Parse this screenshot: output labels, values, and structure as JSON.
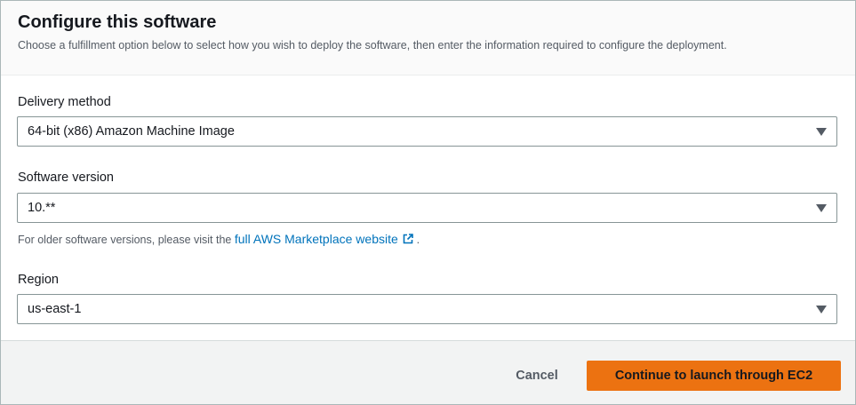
{
  "header": {
    "title": "Configure this software",
    "subtitle": "Choose a fulfillment option below to select how you wish to deploy the software, then enter the information required to configure the deployment."
  },
  "delivery_method": {
    "label": "Delivery method",
    "value": "64-bit (x86) Amazon Machine Image"
  },
  "software_version": {
    "label": "Software version",
    "value": "10.**",
    "hint_prefix": "For older software versions, please visit the",
    "hint_link": "full AWS Marketplace website",
    "hint_suffix": "."
  },
  "region": {
    "label": "Region",
    "value": "us-east-1"
  },
  "footer": {
    "cancel_label": "Cancel",
    "continue_label": "Continue to launch through EC2"
  },
  "colors": {
    "primary_button": "#ec7211",
    "link": "#0073bb"
  },
  "icons": {
    "caret": "caret-down-icon",
    "external": "external-link-icon"
  }
}
